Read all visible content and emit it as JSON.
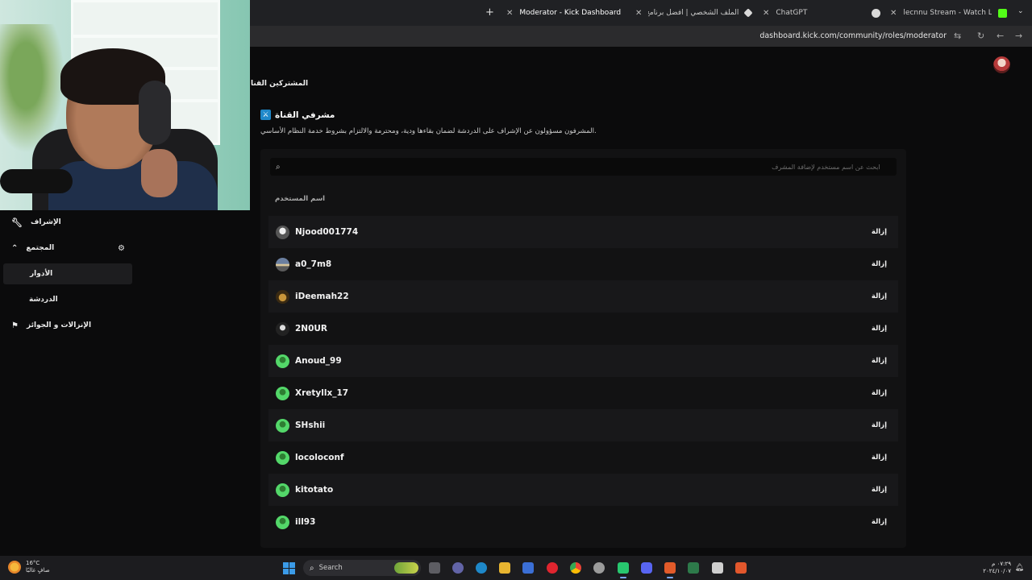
{
  "browser": {
    "tabs": [
      {
        "title": "Moderator - Kick Dashboard",
        "active": true,
        "favicon_color": "#53fc18"
      },
      {
        "title": "الملف الشخصي | أفضل برنامج لـ",
        "active": false,
        "favicon_color": "#d9d9d9"
      },
      {
        "title": "ChatGPT",
        "active": false,
        "favicon_color": "#d9d9d9"
      },
      {
        "title": "lecnnu Stream - Watch Live on",
        "active": false,
        "favicon_color": "#53fc18"
      }
    ],
    "new_tab": "+",
    "url": "dashboard.kick.com/community/roles/moderator"
  },
  "page": {
    "subscribers_heading": "المشتركين القنا",
    "section_title": "مشرفي القناة",
    "section_desc": "المشرفون مسؤولون عن الإشراف على الدردشة لضمان بقاءها ودية، ومحترمة والالتزام بشروط خدمة النظام الأساسي.",
    "search_placeholder": "ابحث عن اسم مستخدم لإضافة المشرف",
    "column_header": "اسم المستخدم",
    "remove_label": "إزالة",
    "moderators": [
      {
        "name": "Njood001774",
        "avatar": "p1"
      },
      {
        "name": "a0_7m8",
        "avatar": "p2"
      },
      {
        "name": "iDeemah22",
        "avatar": "p3"
      },
      {
        "name": "2N0UR",
        "avatar": "p4"
      },
      {
        "name": "Anoud_99",
        "avatar": "g"
      },
      {
        "name": "Xretyllx_17",
        "avatar": "g"
      },
      {
        "name": "SHshii",
        "avatar": "g"
      },
      {
        "name": "locoloconf",
        "avatar": "g"
      },
      {
        "name": "kitotato",
        "avatar": "g"
      },
      {
        "name": "ill93",
        "avatar": "g"
      }
    ]
  },
  "sidebar": {
    "moderation": "الإشراف",
    "community": "المجتمع",
    "roles": "الأدوار",
    "chat": "الدردشة",
    "rewards": "الإنزالات و الجوائز"
  },
  "taskbar": {
    "weather_temp": "16°C",
    "weather_desc": "صافٍ غالبًا",
    "search_label": "Search",
    "time": "٠٧:٢٩ م",
    "date": "٢٠٢٤/١٠/٠٧"
  },
  "accent_color": "#53fc18"
}
